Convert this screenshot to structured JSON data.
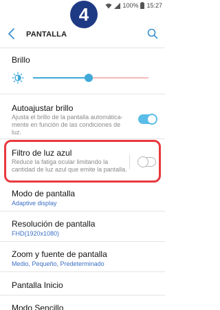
{
  "status_bar": {
    "battery_pct": "100%",
    "time": "15:27"
  },
  "step_badge": "4",
  "app_bar": {
    "title": "PANTALLA"
  },
  "brightness": {
    "label": "Brillo",
    "level": 0.48
  },
  "auto_brightness": {
    "title": "Autoajustar brillo",
    "description": "Ajusta el brillo de la pantalla automática-mente en función de las condiciones de luz.",
    "enabled": true
  },
  "blue_light_filter": {
    "title": "Filtro de luz azul",
    "description": "Reduce la fatiga ocular limitando la cantidad de luz azul que emite la pantalla.",
    "enabled": false
  },
  "screen_mode": {
    "title": "Modo de pantalla",
    "value": "Adaptive display"
  },
  "resolution": {
    "title": "Resolución de pantalla",
    "value": "FHD(1920x1080)"
  },
  "zoom_font": {
    "title": "Zoom y fuente de pantalla",
    "value": "Medio, Pequeño, Predeterminado"
  },
  "home_screen": {
    "title": "Pantalla Inicio"
  },
  "easy_mode": {
    "title": "Modo Sencillo"
  },
  "colors": {
    "accent": "#3fa9d8",
    "highlight": "#e8383d",
    "badge": "#1f3a85",
    "subtext_link": "#3a6fc4"
  }
}
